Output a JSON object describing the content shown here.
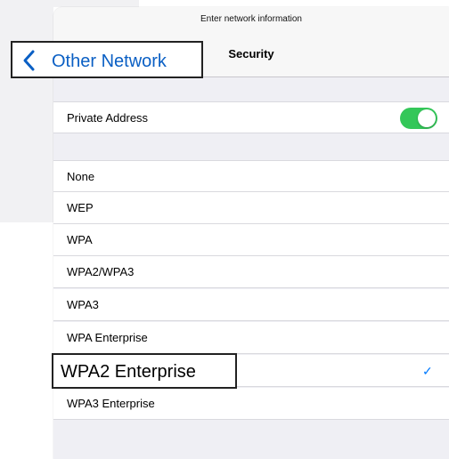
{
  "header": {
    "title": "Enter network information",
    "subtitle": "Security"
  },
  "back_button": {
    "label": "Other Network",
    "icon": "chevron-left-icon",
    "color": "#0a5fc4"
  },
  "private_address": {
    "label": "Private Address",
    "toggle_on": true,
    "toggle_color": "#34c759"
  },
  "security_options": [
    {
      "label": "None",
      "selected": false
    },
    {
      "label": "WEP",
      "selected": false
    },
    {
      "label": "WPA",
      "selected": false
    },
    {
      "label": "WPA2/WPA3",
      "selected": false
    },
    {
      "label": "WPA3",
      "selected": false
    },
    {
      "label": "WPA Enterprise",
      "selected": false
    },
    {
      "label": "WPA2 Enterprise",
      "selected": true
    },
    {
      "label": "WPA3 Enterprise",
      "selected": false
    }
  ],
  "checkmark": "✓",
  "accent_color": "#007aff"
}
